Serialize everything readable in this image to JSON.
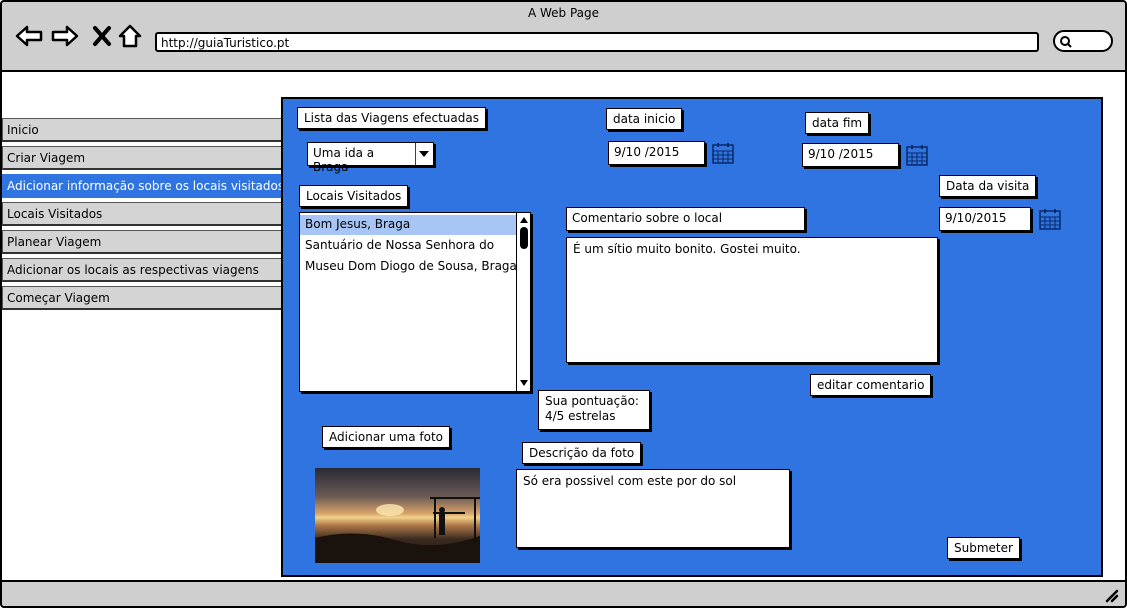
{
  "browser": {
    "title": "A Web Page",
    "url": "http://guiaTuristico.pt"
  },
  "sidebar": {
    "items": [
      {
        "label": "Inicio"
      },
      {
        "label": "Criar Viagem"
      },
      {
        "label": "Adicionar informação sobre os locais visitados",
        "active": true
      },
      {
        "label": "Locais Visitados"
      },
      {
        "label": "Planear Viagem"
      },
      {
        "label": "Adicionar os locais as respectivas viagens"
      },
      {
        "label": "Começar Viagem"
      }
    ]
  },
  "main": {
    "trips_label": "Lista das Viagens efectuadas",
    "trip_select_value": "Uma ida a Braga",
    "start_date_label": "data inicio",
    "start_date_value": "9/10 /2015",
    "end_date_label": "data fim",
    "end_date_value": "9/10 /2015",
    "visited_label": "Locais Visitados",
    "visited_items": [
      "Bom Jesus, Braga",
      "Santuário de Nossa Senhora do",
      "Museu Dom Diogo de Sousa, Braga"
    ],
    "visit_date_label": "Data da visita",
    "visit_date_value": "9/10/2015",
    "comment_label": "Comentario sobre o local",
    "comment_text": "É um sítio muito bonito. Gostei muito.",
    "edit_comment_button": "editar comentario",
    "rating_line1": "Sua pontuação:",
    "rating_line2": "4/5 estrelas",
    "add_photo_button": "Adicionar uma foto",
    "photo_desc_label": "Descrição da foto",
    "photo_desc_text": "Só era possivel com este por do sol",
    "submit_button": "Submeter"
  },
  "icons": {
    "back": "back-arrow-icon",
    "forward": "forward-arrow-icon",
    "close": "close-icon",
    "home": "home-icon",
    "search": "search-icon",
    "calendar": "calendar-icon",
    "dropdown": "chevron-down-icon",
    "resize": "resize-grip-icon"
  },
  "colors": {
    "panel": "#2f74e0",
    "selected_item": "#a8c6f5",
    "chrome": "#cfcfcf"
  }
}
